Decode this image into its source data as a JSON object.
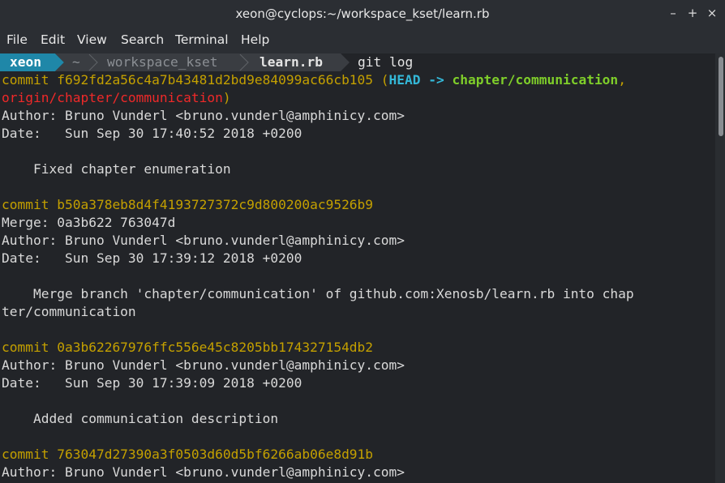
{
  "window": {
    "title": "xeon@cyclops:~/workspace_kset/learn.rb"
  },
  "menu": [
    "File",
    "Edit",
    "View",
    "Search",
    "Terminal",
    "Help"
  ],
  "prompt": {
    "user": "xeon",
    "home": "~",
    "dir1": "workspace_kset",
    "dir2": "learn.rb",
    "command": "git log"
  },
  "log": {
    "c1_hash": "commit f692fd2a56c4a7b43481d2bd9e84099ac66cb105 (",
    "c1_head": "HEAD -> ",
    "c1_branch": "chapter/communication",
    "c1_comma": ",",
    "c1_origin": "origin/chapter/communication",
    "c1_close": ")",
    "c1_author": "Author: Bruno Vunderl <bruno.vunderl@amphinicy.com>",
    "c1_date": "Date:   Sun Sep 30 17:40:52 2018 +0200",
    "c1_msg": "    Fixed chapter enumeration",
    "c2_hash": "commit b50a378eb8d4f4193727372c9d800200ac9526b9",
    "c2_merge": "Merge: 0a3b622 763047d",
    "c2_author": "Author: Bruno Vunderl <bruno.vunderl@amphinicy.com>",
    "c2_date": "Date:   Sun Sep 30 17:39:12 2018 +0200",
    "c2_msg1": "    Merge branch 'chapter/communication' of github.com:Xenosb/learn.rb into chap",
    "c2_msg2": "ter/communication",
    "c3_hash": "commit 0a3b62267976ffc556e45c8205bb174327154db2",
    "c3_author": "Author: Bruno Vunderl <bruno.vunderl@amphinicy.com>",
    "c3_date": "Date:   Sun Sep 30 17:39:09 2018 +0200",
    "c3_msg": "    Added communication description",
    "c4_hash": "commit 763047d27390a3f0503d60d5bf6266ab06e8d91b",
    "c4_author": "Author: Bruno Vunderl <bruno.vunderl@amphinicy.com>"
  },
  "colors": {
    "commit": "#c4a000",
    "head": "#34b8d8",
    "branch": "#7fce2a",
    "origin": "#ef2929",
    "prompt_user_bg": "#1f87a8"
  }
}
